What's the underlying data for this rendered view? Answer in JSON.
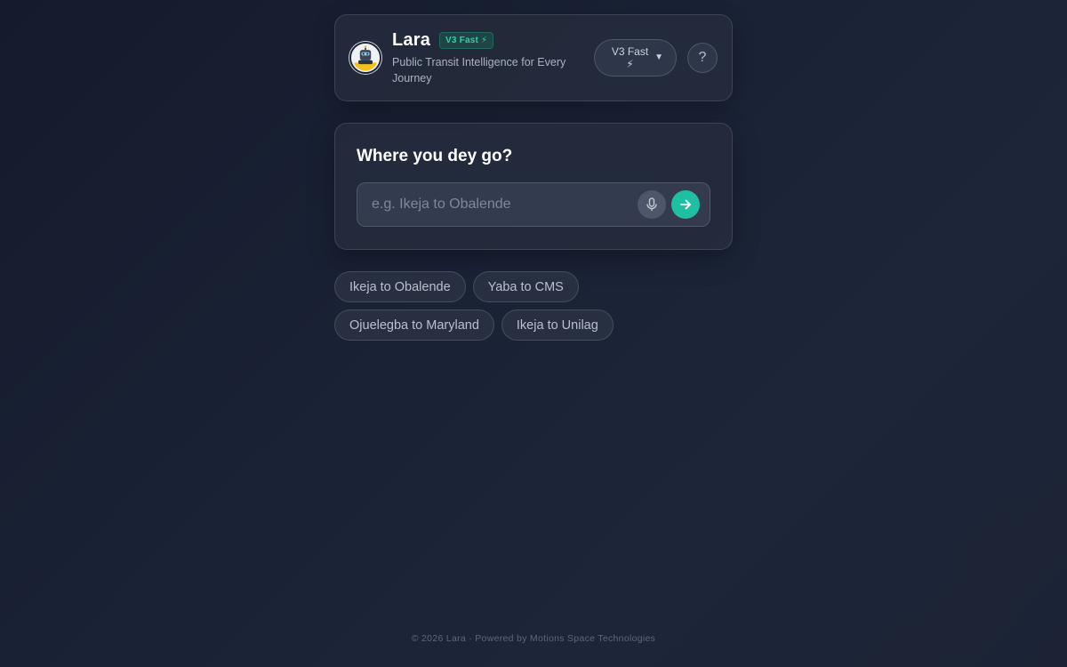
{
  "header": {
    "brand_name": "Lara",
    "badge": "V3 Fast ⚡",
    "subtitle": "Public Transit Intelligence for Every Journey",
    "model_select": {
      "selected": "V3 Fast ⚡"
    },
    "help_label": "?"
  },
  "search": {
    "title": "Where you dey go?",
    "placeholder": "e.g. Ikeja to Obalende",
    "value": ""
  },
  "suggestions": [
    "Ikeja to Obalende",
    "Yaba to CMS",
    "Ojuelegba to Maryland",
    "Ikeja to Unilag"
  ],
  "footer": {
    "text": "© 2026 Lara · Powered by Motions Space Technologies"
  },
  "colors": {
    "accent": "#1fbfa3",
    "badge_text": "#2fd1a5",
    "background": "#1a2236"
  },
  "icons": {
    "avatar": "robot-avatar-icon",
    "chevron": "chevron-down-icon",
    "mic": "microphone-icon",
    "send": "arrow-right-icon"
  }
}
